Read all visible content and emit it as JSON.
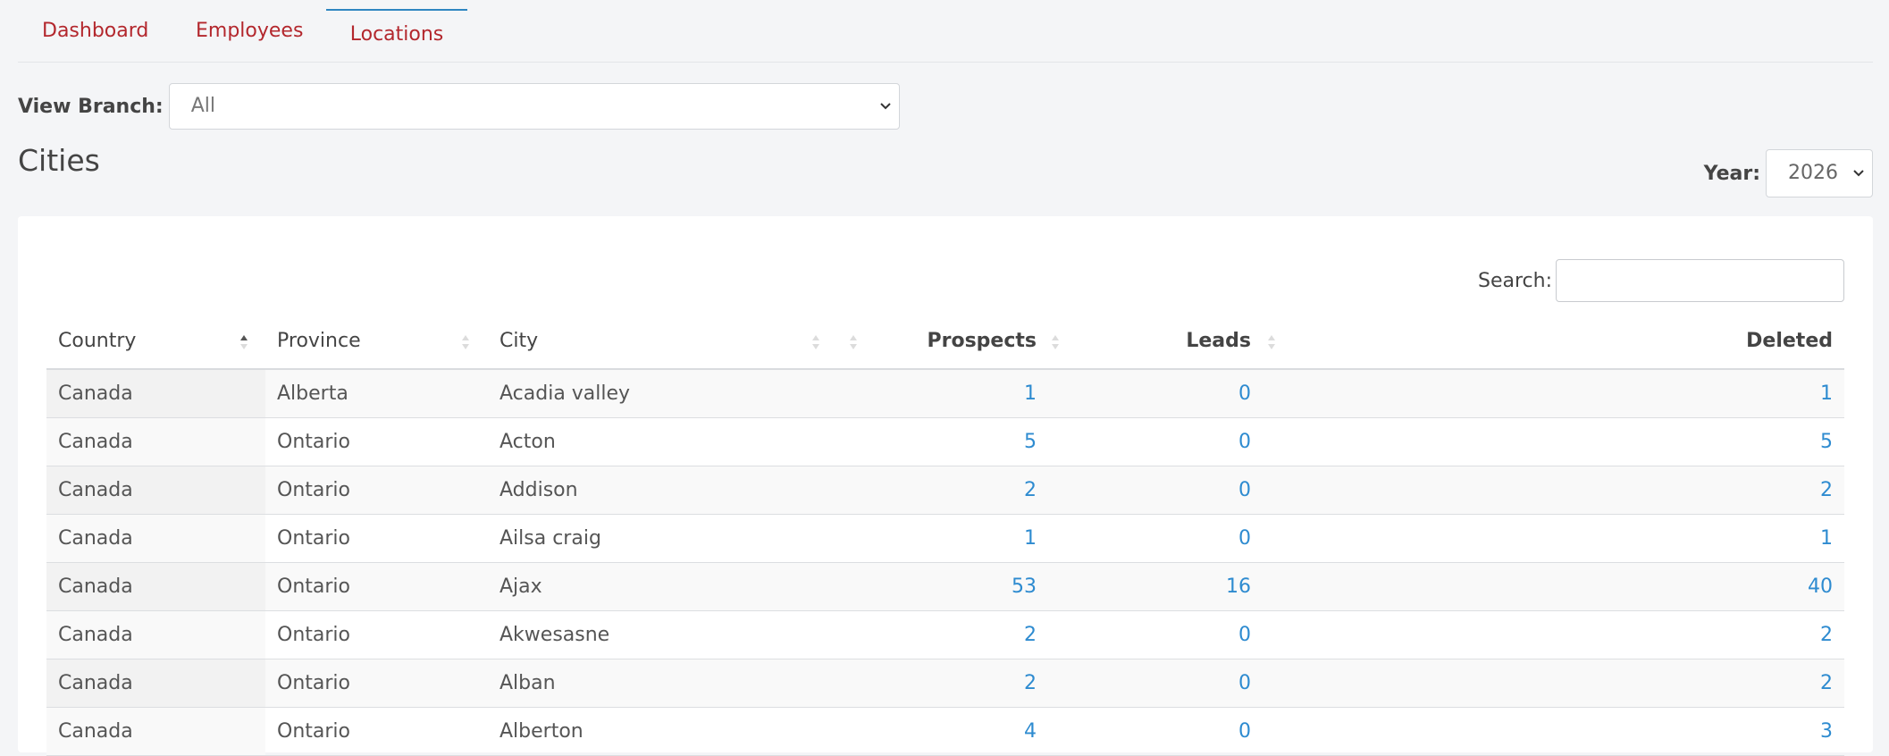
{
  "nav": {
    "tabs": [
      {
        "label": "Dashboard",
        "active": false
      },
      {
        "label": "Employees",
        "active": false
      },
      {
        "label": "Locations",
        "active": true
      }
    ]
  },
  "branch": {
    "label": "View Branch:",
    "selected": "All"
  },
  "page": {
    "title": "Cities"
  },
  "year": {
    "label": "Year:",
    "selected": "2026"
  },
  "search": {
    "label": "Search:",
    "value": ""
  },
  "table": {
    "headers": [
      "Country",
      "Province",
      "City",
      "Prospects",
      "Leads",
      "Deleted"
    ],
    "rows": [
      {
        "country": "Canada",
        "province": "Alberta",
        "city": "Acadia valley",
        "prospects": "1",
        "leads": "0",
        "deleted": "1"
      },
      {
        "country": "Canada",
        "province": "Ontario",
        "city": "Acton",
        "prospects": "5",
        "leads": "0",
        "deleted": "5"
      },
      {
        "country": "Canada",
        "province": "Ontario",
        "city": "Addison",
        "prospects": "2",
        "leads": "0",
        "deleted": "2"
      },
      {
        "country": "Canada",
        "province": "Ontario",
        "city": "Ailsa craig",
        "prospects": "1",
        "leads": "0",
        "deleted": "1"
      },
      {
        "country": "Canada",
        "province": "Ontario",
        "city": "Ajax",
        "prospects": "53",
        "leads": "16",
        "deleted": "40"
      },
      {
        "country": "Canada",
        "province": "Ontario",
        "city": "Akwesasne",
        "prospects": "2",
        "leads": "0",
        "deleted": "2"
      },
      {
        "country": "Canada",
        "province": "Ontario",
        "city": "Alban",
        "prospects": "2",
        "leads": "0",
        "deleted": "2"
      },
      {
        "country": "Canada",
        "province": "Ontario",
        "city": "Alberton",
        "prospects": "4",
        "leads": "0",
        "deleted": "3"
      }
    ]
  },
  "colors": {
    "tab_text": "#b3272d",
    "active_tab_border": "#2e86c1",
    "link_number": "#2e8bd0"
  }
}
